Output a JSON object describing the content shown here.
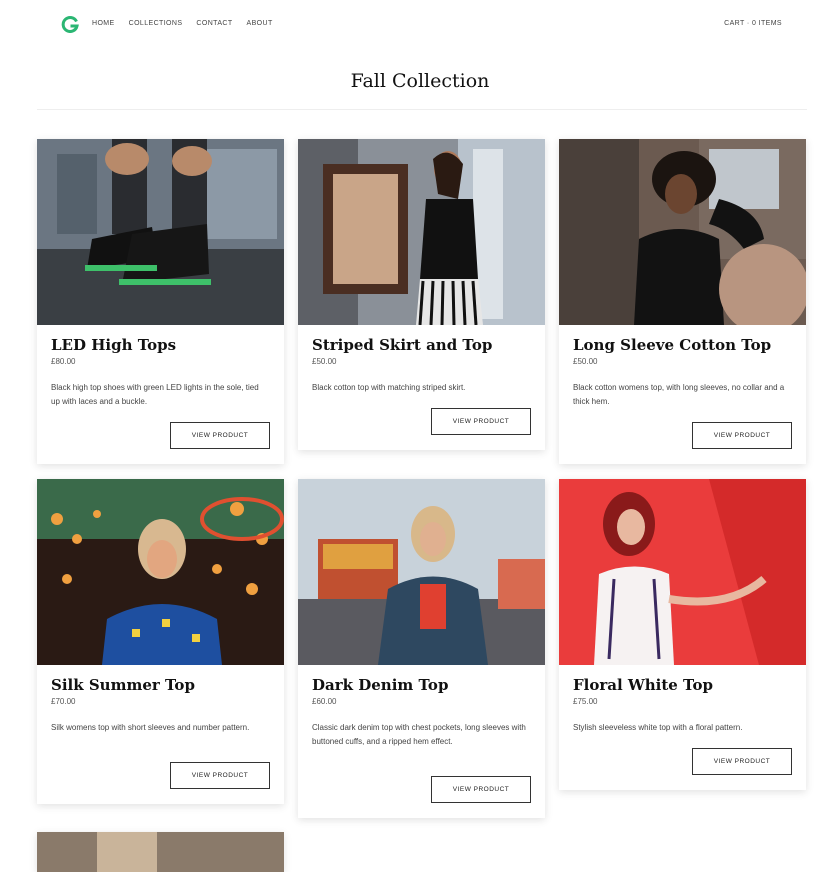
{
  "nav": {
    "items": [
      "HOME",
      "COLLECTIONS",
      "CONTACT",
      "ABOUT"
    ],
    "cart_label": "CART · 0 ITEMS"
  },
  "page": {
    "title": "Fall Collection"
  },
  "products": [
    {
      "name": "LED High Tops",
      "price": "£80.00",
      "description": "Black high top shoes with green LED lights in the sole, tied up with laces and a buckle.",
      "button": "VIEW PRODUCT"
    },
    {
      "name": "Striped Skirt and Top",
      "price": "£50.00",
      "description": "Black cotton top with matching striped skirt.",
      "button": "VIEW PRODUCT"
    },
    {
      "name": "Long Sleeve Cotton Top",
      "price": "£50.00",
      "description": "Black cotton womens top, with long sleeves, no collar and a thick hem.",
      "button": "VIEW PRODUCT"
    },
    {
      "name": "Silk Summer Top",
      "price": "£70.00",
      "description": "Silk womens top with short sleeves and number pattern.",
      "button": "VIEW PRODUCT"
    },
    {
      "name": "Dark Denim Top",
      "price": "£60.00",
      "description": "Classic dark denim top with chest pockets, long sleeves with buttoned cuffs, and a ripped hem effect.",
      "button": "VIEW PRODUCT"
    },
    {
      "name": "Floral White Top",
      "price": "£75.00",
      "description": "Stylish sleeveless white top with a floral pattern.",
      "button": "VIEW PRODUCT"
    }
  ],
  "colors": {
    "brand_green": "#2bb673",
    "text": "#222222",
    "border": "#333333"
  }
}
